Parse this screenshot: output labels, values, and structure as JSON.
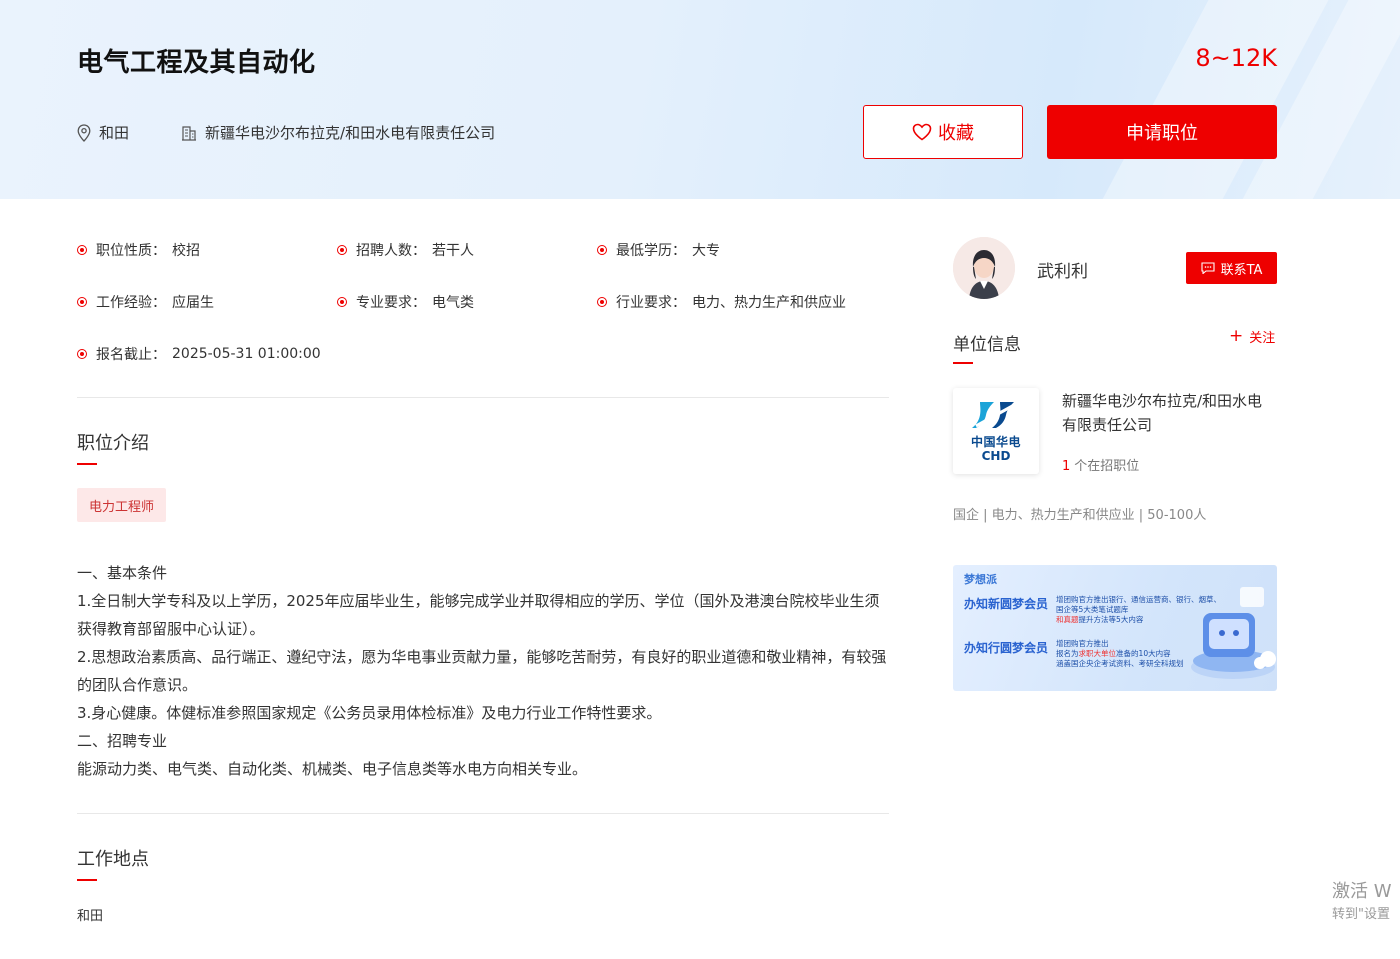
{
  "job": {
    "title": "电气工程及其自动化",
    "salary": "8~12K",
    "location": "和田",
    "company": "新疆华电沙尔布拉克/和田水电有限责任公司",
    "favorite_label": "收藏",
    "apply_label": "申请职位"
  },
  "attributes": [
    {
      "key": "职位性质：",
      "value": "校招"
    },
    {
      "key": "招聘人数：",
      "value": "若干人"
    },
    {
      "key": "最低学历：",
      "value": "大专"
    },
    {
      "key": "工作经验：",
      "value": "应届生"
    },
    {
      "key": "专业要求：",
      "value": "电气类"
    },
    {
      "key": "行业要求：",
      "value": "电力、热力生产和供应业"
    },
    {
      "key": "报名截止：",
      "value": "2025-05-31 01:00:00"
    }
  ],
  "intro": {
    "title": "职位介绍",
    "tag": "电力工程师",
    "lines": [
      "一、基本条件",
      "1.全日制大学专科及以上学历，2025年应届毕业生，能够完成学业并取得相应的学历、学位（国外及港澳台院校毕业生须获得教育部留服中心认证）。",
      "2.思想政治素质高、品行端正、遵纪守法，愿为华电事业贡献力量，能够吃苦耐劳，有良好的职业道德和敬业精神，有较强的团队合作意识。",
      "3.身心健康。体健标准参照国家规定《公务员录用体检标准》及电力行业工作特性要求。",
      "二、招聘专业",
      "能源动力类、电气类、自动化类、机械类、电子信息类等水电方向相关专业。"
    ]
  },
  "work_location": {
    "title": "工作地点",
    "value": "和田"
  },
  "recruiter": {
    "name": "武利利",
    "contact_label": "联系TA"
  },
  "unit": {
    "title": "单位信息",
    "follow_label": "关注",
    "logo_cn": "中国华电",
    "logo_en": "CHD",
    "name": "新疆华电沙尔布拉克/和田水电有限责任公司",
    "openings_count": "1",
    "openings_label": "个在招职位",
    "tags": "国企 | 电力、热力生产和供应业 | 50-100人"
  },
  "ad": {
    "brand": "梦想派",
    "row1_title": "办",
    "row1_title_accent": "知新",
    "row1_title_rest": "圆梦会员",
    "row1_sub": "",
    "row1_text1": "增团购官方推出银行、通信运营商、银行、烟草、",
    "row1_text2": "国企等5大类笔试题库",
    "row1_text3": "和真题",
    "row1_text4": "提升方法等5大内容",
    "row2_title": "办",
    "row2_title_accent": "知行",
    "row2_title_rest": "圆梦会员",
    "row2_text1": "增团购官方推出",
    "row2_text2": "报名为",
    "row2_text2_accent": "求职大单位",
    "row2_text2_rest": "准备的10大内容",
    "row2_text3": "涵盖国企央企考试资料、考研全科规划"
  },
  "watermark": {
    "line1": "激活 W",
    "line2": "转到\"设置"
  },
  "colors": {
    "accent": "#ee0000",
    "tag_bg": "#fde8e8"
  }
}
